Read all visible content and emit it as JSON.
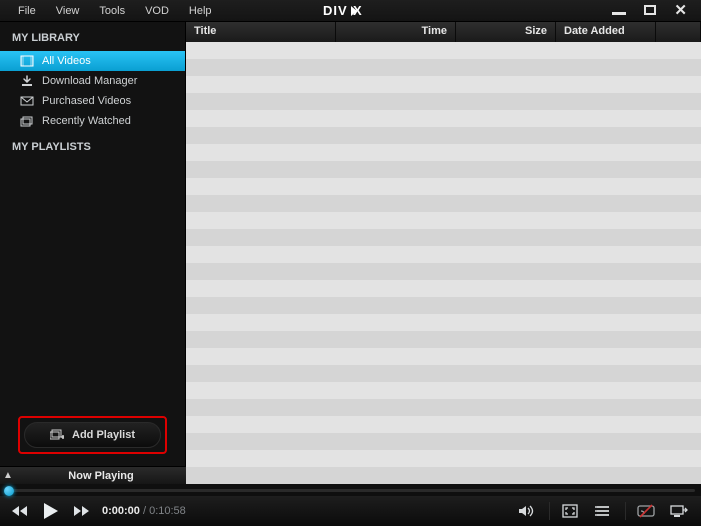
{
  "menu": {
    "file": "File",
    "view": "View",
    "tools": "Tools",
    "vod": "VOD",
    "help": "Help"
  },
  "brand": "DIVX",
  "sections": {
    "library": "MY LIBRARY",
    "playlists": "MY PLAYLISTS"
  },
  "library": {
    "all_videos": "All Videos",
    "download_manager": "Download Manager",
    "purchased": "Purchased Videos",
    "recent": "Recently Watched"
  },
  "add_playlist": "Add Playlist",
  "columns": {
    "title": "Title",
    "time": "Time",
    "size": "Size",
    "date_added": "Date Added"
  },
  "now_playing": "Now Playing",
  "playback": {
    "current": "0:00:00",
    "duration": "0:10:58"
  }
}
